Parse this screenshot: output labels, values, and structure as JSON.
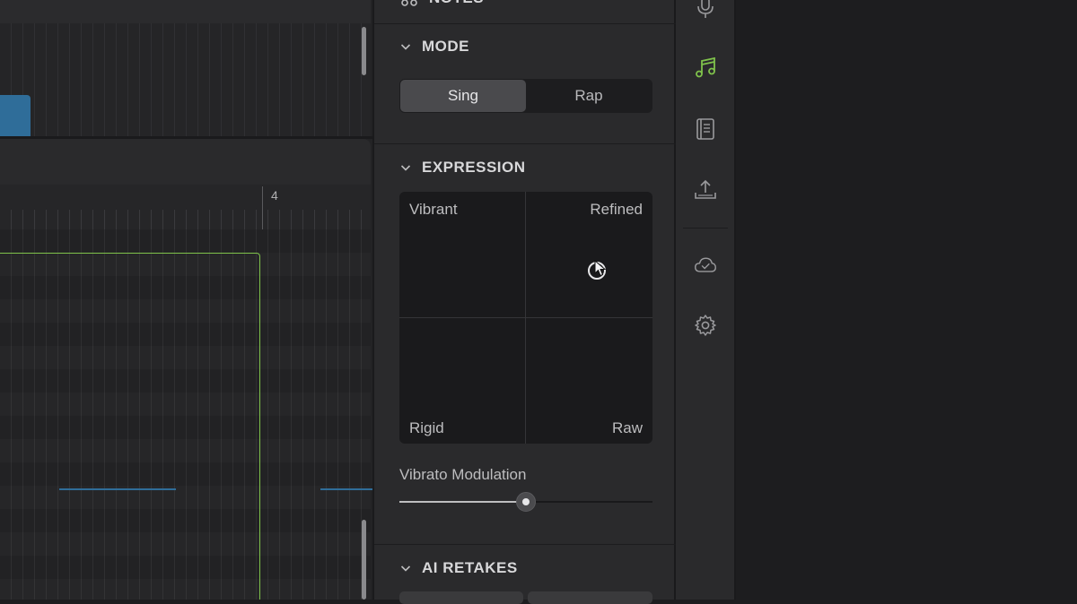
{
  "editor": {
    "bar_number": "4"
  },
  "panel": {
    "notes_section": {
      "title": "NOTES"
    },
    "mode_section": {
      "title": "MODE",
      "options": [
        "Sing",
        "Rap"
      ],
      "selected": "Sing"
    },
    "expression_section": {
      "title": "EXPRESSION",
      "corner_labels": {
        "top_left": "Vibrant",
        "top_right": "Refined",
        "bottom_left": "Rigid",
        "bottom_right": "Raw"
      }
    },
    "vibrato": {
      "label": "Vibrato Modulation",
      "value_fraction": 0.5
    },
    "ai_retakes_section": {
      "title": "AI RETAKES"
    }
  },
  "rail": {
    "icons": [
      "microphone-icon",
      "music-notes-icon",
      "book-icon",
      "export-icon",
      "cloud-check-icon",
      "gear-icon"
    ],
    "active": "music-notes-icon",
    "accent_color": "#7fc24b"
  },
  "colors": {
    "region_outline": "#7fc24b",
    "note_blue": "#2f6d99"
  }
}
